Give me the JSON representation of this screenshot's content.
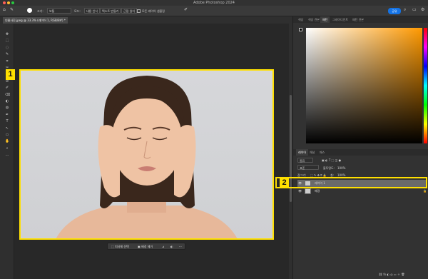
{
  "app": {
    "title": "Adobe Photoshop 2024"
  },
  "options_bar": {
    "brush_label": "크기:",
    "brush_value": "보통",
    "mode_label": "모드:",
    "btn_content_select": "내용 인식",
    "btn_text_create": "텍스트 만들기",
    "btn_sample": "근접 일치",
    "sample_all_layers": "모든 레이어 샘플링",
    "share": "공유"
  },
  "document_tab": "인물사진.jpeg @ 33.3% (레이어 1, RGB/8#) *",
  "tools": [
    "✥",
    "⬚",
    "◌",
    "✎",
    "⌗",
    "✂",
    "◫",
    "⊘",
    "✐",
    "⌫",
    "◐",
    "◍",
    "✒",
    "T",
    "↖",
    "▭",
    "✋",
    "⌕",
    "…"
  ],
  "context_bar": {
    "select_subject": "피사체 선택",
    "remove_bg": "배경 제거",
    "more": "···"
  },
  "color_panel": {
    "tabs": [
      "색상",
      "색상 견본",
      "패턴",
      "그레이디언트",
      "패턴 견본"
    ],
    "active_tab": 2
  },
  "layers_panel": {
    "tabs": [
      "레이어",
      "채널",
      "패스"
    ],
    "kind_label": "종류",
    "blend_mode": "표준",
    "opacity_label": "불투명도:",
    "opacity_value": "100%",
    "lock_label": "잠그기:",
    "fill_label": "칠:",
    "fill_value": "100%",
    "layers": [
      {
        "name": "레이어 1",
        "selected": true
      },
      {
        "name": "배경",
        "selected": false
      }
    ]
  },
  "callouts": {
    "one": "1",
    "two": "2"
  },
  "colors": {
    "highlight": "#ffe000",
    "accent": "#1473e6"
  }
}
